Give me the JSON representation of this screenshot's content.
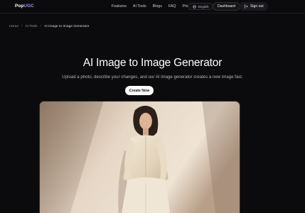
{
  "brand": {
    "part1": "Pop",
    "part2": "UGC"
  },
  "nav": {
    "items": [
      "Features",
      "AI Tools",
      "Blogs",
      "FAQ",
      "Pricing"
    ],
    "language": "English",
    "dashboard_label": "Dashboard",
    "signout_label": "Sign out"
  },
  "breadcrumb": {
    "home": "Home",
    "section": "AI Tools",
    "current": "AI Image to Image Generator"
  },
  "hero": {
    "title": "AI Image to Image Generator",
    "subtitle": "Upload a photo, describe your changes, and our AI image generator creates a new image fast.",
    "cta_label": "Create Now"
  },
  "colors": {
    "background": "#0b0b0d",
    "accent": "#a98bff",
    "button_bg": "#ffffff"
  }
}
